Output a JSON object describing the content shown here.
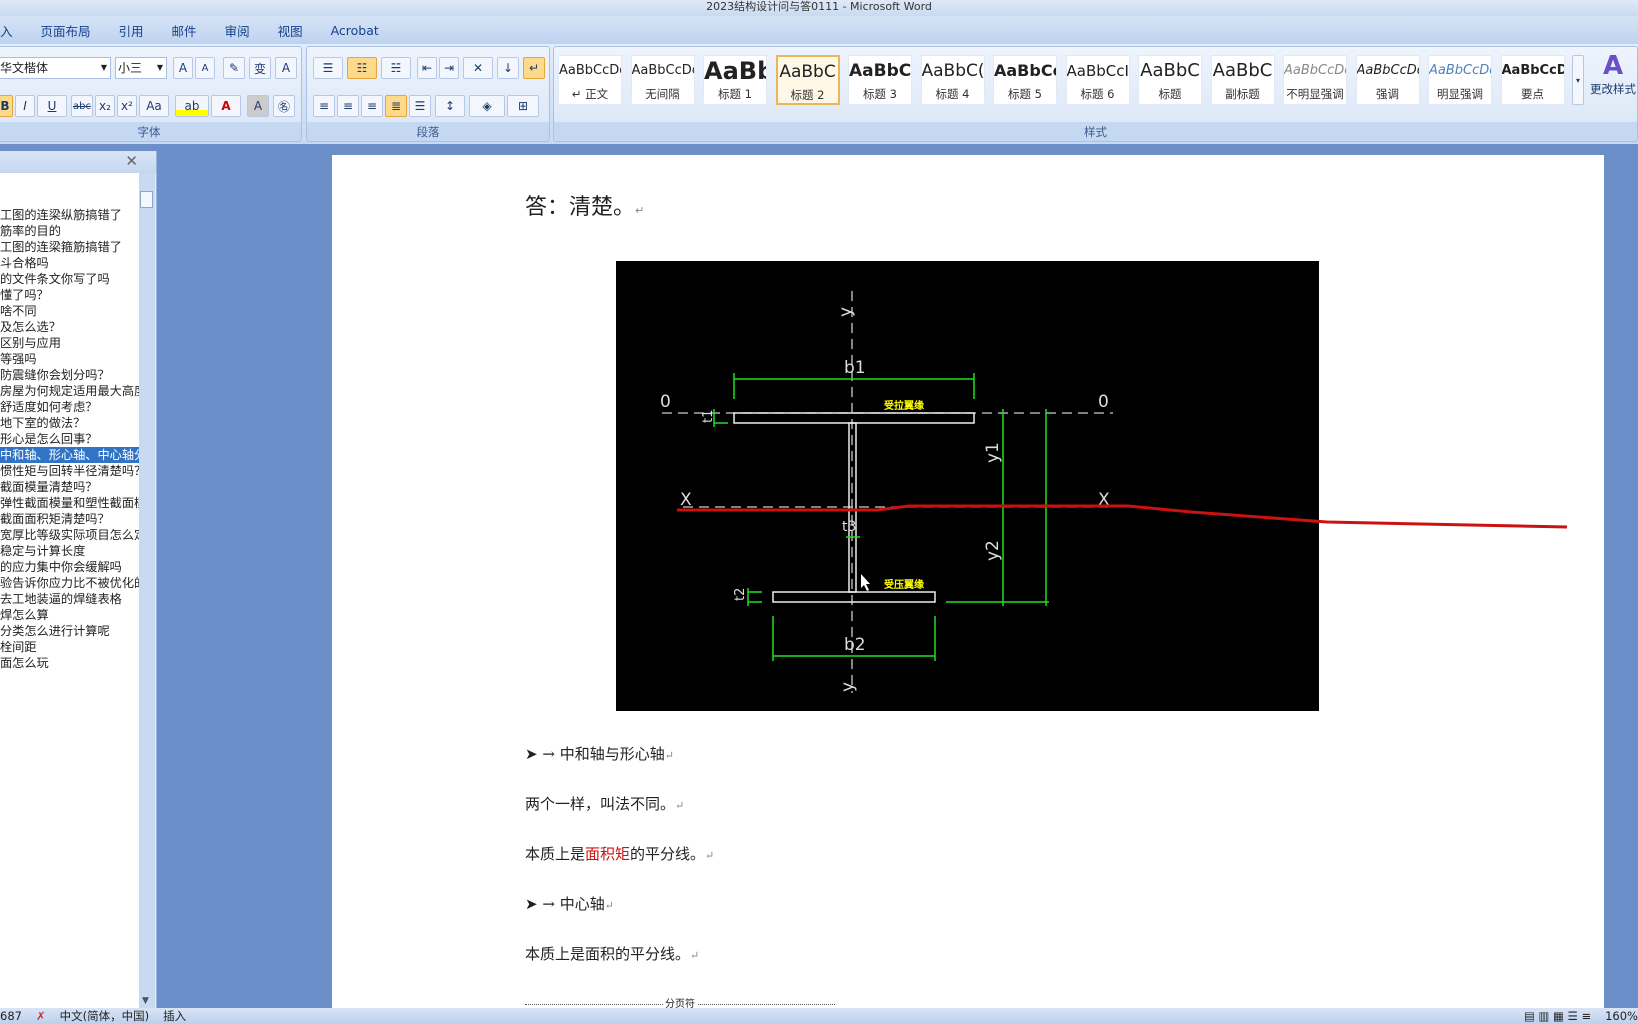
{
  "window": {
    "title": "2023结构设计问与答0111 - Microsoft Word"
  },
  "tabs": [
    "入",
    "页面布局",
    "引用",
    "邮件",
    "审阅",
    "视图",
    "Acrobat"
  ],
  "ribbon": {
    "font": {
      "name": "华文楷体",
      "size": "小三",
      "label": "字体"
    },
    "paragraph": {
      "label": "段落"
    },
    "styles": {
      "label": "样式",
      "change_label": "更改样式",
      "items": [
        {
          "preview": "AaBbCcDd",
          "name": "↵ 正文"
        },
        {
          "preview": "AaBbCcDc",
          "name": "无间隔"
        },
        {
          "preview": "AaBb",
          "name": "标题 1"
        },
        {
          "preview": "AaBbC",
          "name": "标题 2",
          "selected": true
        },
        {
          "preview": "AaBbC(",
          "name": "标题 3"
        },
        {
          "preview": "AaBbC(",
          "name": "标题 4"
        },
        {
          "preview": "AaBbCc",
          "name": "标题 5"
        },
        {
          "preview": "AaBbCcI",
          "name": "标题 6"
        },
        {
          "preview": "AaBbC",
          "name": "标题"
        },
        {
          "preview": "AaBbC",
          "name": "副标题"
        },
        {
          "preview": "AaBbCcDd",
          "name": "不明显强调"
        },
        {
          "preview": "AaBbCcDd",
          "name": "强调"
        },
        {
          "preview": "AaBbCcDd",
          "name": "明显强调"
        },
        {
          "preview": "AaBbCcDd",
          "name": "要点"
        }
      ]
    }
  },
  "nav": {
    "items": [
      "工图的连梁纵筋搞错了",
      "筋率的目的",
      "工图的连梁箍筋搞错了",
      "斗合格吗",
      "的文件条文你写了吗",
      "懂了吗？",
      "啥不同",
      "及怎么选？",
      "区别与应用",
      "等强吗",
      "防震缝你会划分吗？",
      "房屋为何规定适用最大高度",
      "舒适度如何考虑？",
      "地下室的做法？",
      "形心是怎么回事？",
      "中和轴、形心轴、中心轴分",
      "惯性矩与回转半径清楚吗？",
      "截面模量清楚吗？",
      "弹性截面模量和塑性截面模",
      "截面面积矩清楚吗？",
      "宽厚比等级实际项目怎么定",
      "稳定与计算长度",
      "的应力集中你会缓解吗",
      "验告诉你应力比不被优化的",
      "去工地装逼的焊缝表格",
      "焊怎么算",
      "分类怎么进行计算呢",
      "栓间距",
      "面怎么玩"
    ],
    "selected_index": 15
  },
  "doc": {
    "answer": "答：清楚。",
    "figure": {
      "labels": {
        "y": "y",
        "b1": "b1",
        "b2": "b2",
        "o": "0",
        "x": "X",
        "t1": "t1",
        "t2": "t2",
        "t3": "t3",
        "y1": "y1",
        "y2": "y2",
        "tension": "受拉翼缘",
        "compression": "受压翼缘"
      }
    },
    "h1": "中和轴与形心轴",
    "p1": "两个一样，叫法不同。",
    "p2_pre": "本质上是",
    "p2_red": "面积矩",
    "p2_post": "的平分线。",
    "h2": "中心轴",
    "p3": "本质上是面积的平分线。",
    "page_break": "分页符"
  },
  "status": {
    "words": "687",
    "language": "中文(简体，中国)",
    "mode": "插入",
    "zoom": "160%"
  },
  "colors": {
    "annotation": "#cc1111",
    "dimension": "#22dd22",
    "label": "#ffff00"
  }
}
